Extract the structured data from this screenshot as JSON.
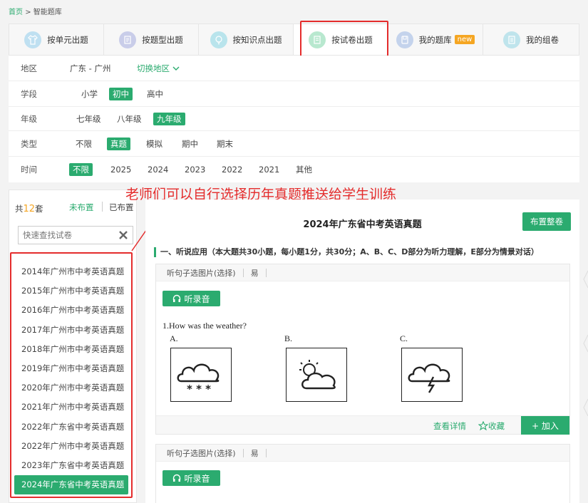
{
  "breadcrumb": {
    "home": "首页",
    "sep": ">",
    "current": "智能题库"
  },
  "tabs": [
    {
      "label": "按单元出题",
      "icon": "t-shirt-icon"
    },
    {
      "label": "按题型出题",
      "icon": "list-icon"
    },
    {
      "label": "按知识点出题",
      "icon": "lightbulb-icon"
    },
    {
      "label": "按试卷出题",
      "icon": "paper-icon",
      "active": true
    },
    {
      "label": "我的题库",
      "icon": "bank-icon",
      "badge": "new"
    },
    {
      "label": "我的组卷",
      "icon": "document-icon"
    }
  ],
  "filters": {
    "region": {
      "label": "地区",
      "value": "广东 - 广州",
      "switch": "切换地区"
    },
    "stage": {
      "label": "学段",
      "options": [
        "小学",
        "初中",
        "高中"
      ],
      "selected": "初中"
    },
    "grade": {
      "label": "年级",
      "options": [
        "七年级",
        "八年级",
        "九年级"
      ],
      "selected": "九年级"
    },
    "type": {
      "label": "类型",
      "options": [
        "不限",
        "真题",
        "模拟",
        "期中",
        "期末"
      ],
      "selected": "真题"
    },
    "time": {
      "label": "时间",
      "options": [
        "不限",
        "2025",
        "2024",
        "2023",
        "2022",
        "2021",
        "其他"
      ],
      "selected": "不限"
    }
  },
  "annotation": "老师们可以自行选择历年真题推送给学生训练",
  "sidebar": {
    "count_prefix": "共",
    "count": "12",
    "count_suffix": "套",
    "toggle_unassigned": "未布置",
    "toggle_assigned": "已布置",
    "search_placeholder": "快速查找试卷",
    "papers": [
      "2014年广州市中考英语真题",
      "2015年广州市中考英语真题",
      "2016年广州市中考英语真题",
      "2017年广州市中考英语真题",
      "2018年广州市中考英语真题",
      "2019年广州市中考英语真题",
      "2020年广州市中考英语真题",
      "2021年广州市中考英语真题",
      "2022年广东省中考英语真题",
      "2022年广州市中考英语真题",
      "2023年广东省中考英语真题",
      "2024年广东省中考英语真题"
    ],
    "selected_index": 11
  },
  "paper": {
    "title": "2024年广东省中考英语真题",
    "assign_button": "布置整卷",
    "section": "一、听说应用（本大题共30小题，每小题1分，共30分；A、B、C、D部分为听力理解，E部分为情景对话）",
    "questions": [
      {
        "type": "听句子选图片(选择)",
        "difficulty": "易",
        "listen_label": "听录音",
        "text": "1.How was the weather?",
        "options": [
          "A.",
          "B.",
          "C."
        ],
        "option_images": [
          "snow-icon",
          "partly-cloudy-icon",
          "thunderstorm-icon"
        ],
        "detail_link": "查看详情",
        "favorite_link": "收藏",
        "add_button": "加入"
      },
      {
        "type": "听句子选图片(选择)",
        "difficulty": "易",
        "listen_label": "听录音"
      }
    ]
  },
  "colors": {
    "accent": "#2bab6f",
    "highlight": "#e42c2c",
    "badge": "#f5a623"
  }
}
